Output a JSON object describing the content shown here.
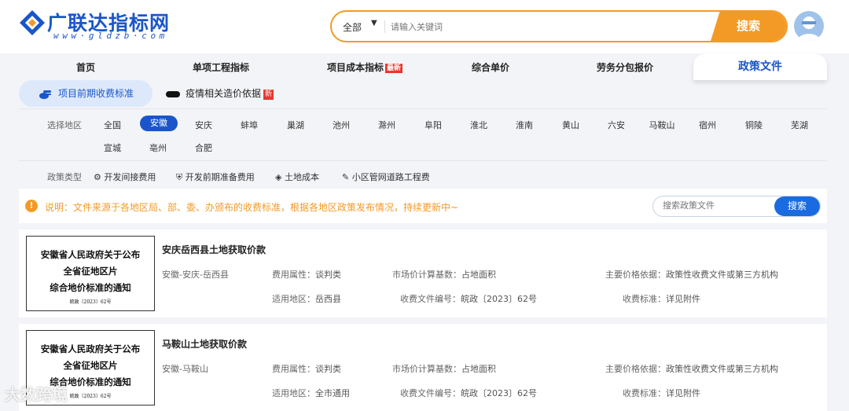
{
  "logo": {
    "text": "广联达指标网",
    "url": "www·gldzb·com"
  },
  "search": {
    "scope": "全部",
    "placeholder": "请输入关键词",
    "button": "搜索"
  },
  "nav": {
    "items": [
      "首页",
      "单项工程指标",
      "项目成本指标",
      "综合单价",
      "劳务分包报价"
    ],
    "badge": "最新",
    "active": "政策文件"
  },
  "subtabs": {
    "active": "项目前期收费标准",
    "second": "疫情相关造价依据",
    "new_badge": "新"
  },
  "filters": {
    "region_label": "选择地区",
    "regions_row1": [
      "全国",
      "安徽",
      "安庆",
      "蚌埠",
      "巢湖",
      "池州",
      "滁州",
      "阜阳",
      "淮北",
      "淮南",
      "黄山",
      "六安",
      "马鞍山",
      "宿州",
      "铜陵",
      "芜湖"
    ],
    "regions_row2": [
      "宣城",
      "亳州",
      "合肥"
    ],
    "active_region": "安徽",
    "type_label": "政策类型",
    "types": [
      "开发间接费用",
      "开发前期准备费用",
      "土地成本",
      "小区管网道路工程费"
    ]
  },
  "notice": {
    "icon": "!",
    "text": "说明：文件来源于各地区局、部、委、办颁布的收费标准，根据各地区政策发布情况，持续更新中~",
    "search_placeholder": "搜索政策文件",
    "search_button": "搜索"
  },
  "cards": [
    {
      "thumb": [
        "安徽省人民政府关于公布",
        "全省征地区片",
        "综合地价标准的通知"
      ],
      "thumb_no": "皖政〔2023〕62号",
      "title": "安庆岳西县土地获取价款",
      "location": "安徽-安庆-岳西县",
      "fee_attr_label": "费用属性：",
      "fee_attr": "谈判类",
      "base_label": "市场价计算基数：",
      "base": "占地面积",
      "basis_label": "主要价格依据：",
      "basis": "政策性收费文件或第三方机构",
      "area_label": "适用地区：",
      "area": "岳西县",
      "doc_no_label": "收费文件编号：",
      "doc_no": "皖政〔2023〕62号",
      "std_label": "收费标准：",
      "std": "详见附件"
    },
    {
      "thumb": [
        "安徽省人民政府关于公布",
        "全省征地区片",
        "综合地价标准的通知"
      ],
      "thumb_no": "皖政〔2023〕62号",
      "title": "马鞍山土地获取价款",
      "location": "安徽-马鞍山",
      "fee_attr_label": "费用属性：",
      "fee_attr": "谈判类",
      "base_label": "市场价计算基数：",
      "base": "占地面积",
      "basis_label": "主要价格依据：",
      "basis": "政策性收费文件或第三方机构",
      "area_label": "适用地区：",
      "area": "全市通用",
      "doc_no_label": "收费文件编号：",
      "doc_no": "皖政〔2023〕62号",
      "std_label": "收费标准：",
      "std": "详见附件"
    }
  ],
  "watermark": "大数跨境",
  "colors": {
    "brand": "#1a56c9",
    "accent": "#f39a26",
    "badge": "#e8372f"
  }
}
